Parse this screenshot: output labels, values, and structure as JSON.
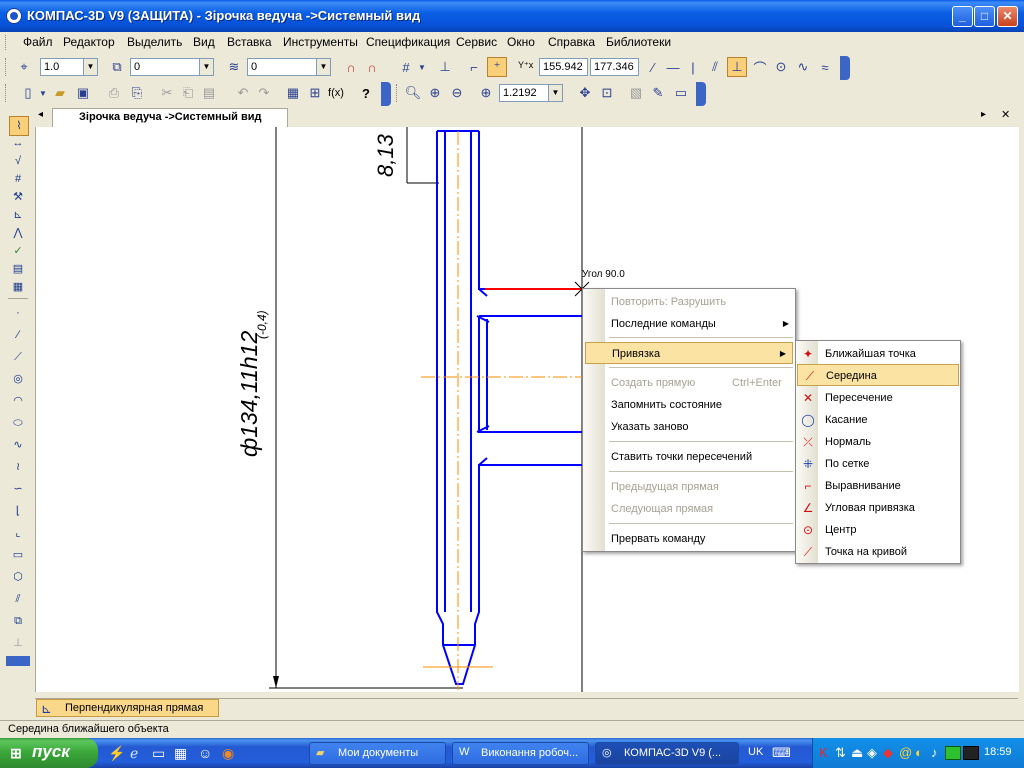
{
  "window": {
    "title": "КОМПАС-3D V9 (ЗАЩИТА) - Зірочка ведуча ->Системный вид",
    "minimize": "_",
    "maximize": "□",
    "close": "✕"
  },
  "menubar": {
    "items": [
      "Файл",
      "Редактор",
      "Выделить",
      "Вид",
      "Вставка",
      "Инструменты",
      "Спецификация",
      "Сервис",
      "Окно",
      "Справка",
      "Библиотеки"
    ]
  },
  "toolbar1": {
    "line_scale": "1.0",
    "layer_field": "0",
    "style_field": "0",
    "coord_x": "155.942",
    "coord_y": "177.346"
  },
  "toolbar2": {
    "fx_label": "f(x)",
    "help_label": "?",
    "zoom_value": "1.2192"
  },
  "document_tab": {
    "title": "Зірочка ведуча ->Системный вид"
  },
  "drawing": {
    "dim_top": "8,13",
    "dim_diameter": "ф134,11h12",
    "dim_tolerance": "(-0,4)",
    "cursor_label": "Угол 90.0"
  },
  "context_menu": {
    "items": [
      {
        "label": "Повторить: Разрушить",
        "disabled": true
      },
      {
        "label": "Последние команды",
        "submenu": true
      },
      {
        "label": "Привязка",
        "submenu": true,
        "highlight": true
      },
      {
        "label": "Создать прямую",
        "shortcut": "Ctrl+Enter",
        "disabled": true
      },
      {
        "label": "Запомнить состояние"
      },
      {
        "label": "Указать заново"
      },
      {
        "label": "Ставить точки пересечений"
      },
      {
        "label": "Предыдущая прямая",
        "disabled": true
      },
      {
        "label": "Следующая прямая",
        "disabled": true
      },
      {
        "label": "Прервать команду"
      }
    ]
  },
  "snap_submenu": {
    "items": [
      {
        "label": "Ближайшая точка",
        "icon": "nearest-point-icon"
      },
      {
        "label": "Середина",
        "icon": "midpoint-icon",
        "highlight": true
      },
      {
        "label": "Пересечение",
        "icon": "intersection-icon"
      },
      {
        "label": "Касание",
        "icon": "tangent-icon"
      },
      {
        "label": "Нормаль",
        "icon": "normal-icon"
      },
      {
        "label": "По сетке",
        "icon": "grid-snap-icon"
      },
      {
        "label": "Выравнивание",
        "icon": "alignment-icon"
      },
      {
        "label": "Угловая привязка",
        "icon": "angle-snap-icon"
      },
      {
        "label": "Центр",
        "icon": "center-icon"
      },
      {
        "label": "Точка на кривой",
        "icon": "point-on-curve-icon"
      }
    ]
  },
  "bottom_tab": {
    "label": "Перпендикулярная прямая"
  },
  "statusbar": {
    "text": "Середина ближайшего объекта"
  },
  "taskbar": {
    "start": "пуск",
    "tasks": [
      "Мои документы",
      "Виконання робоч...",
      "КОМПАС-3D V9 (..."
    ],
    "language": "UK",
    "clock": "18:59"
  },
  "colors": {
    "drawing_blue": "#0000ff",
    "centerline_orange": "#ff8c00",
    "red_line": "#ff0000",
    "menu_highlight": "#fbe3a3"
  }
}
